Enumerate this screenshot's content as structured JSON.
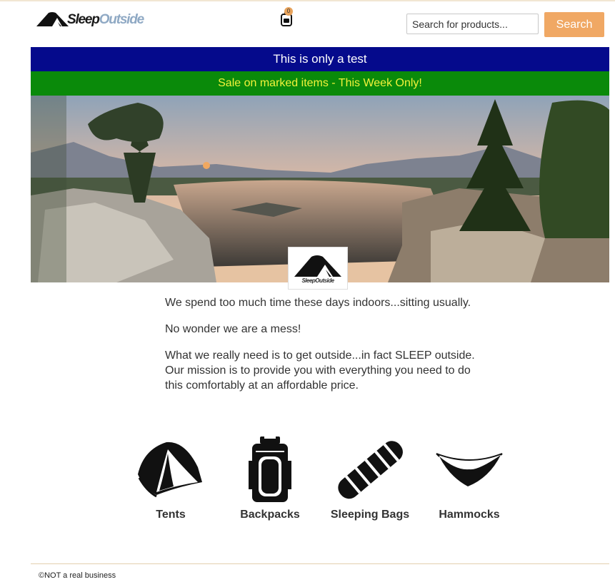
{
  "header": {
    "logo": {
      "text_main": "Sleep",
      "text_accent": "Outside",
      "icon": "tent-icon"
    },
    "cart": {
      "icon": "backpack-cart-icon",
      "count": "0"
    },
    "search": {
      "placeholder": "Search for products...",
      "button_label": "Search"
    }
  },
  "alerts": [
    {
      "text": "This is only a test",
      "background": "#050a8c",
      "color": "#ffffff"
    },
    {
      "text": "Sale on marked items - This Week Only!",
      "background": "#0a8a0a",
      "color": "#f2f23a"
    }
  ],
  "hero": {
    "image": "mountain-lake-sunset-photo",
    "badge_text": "SleepOutside"
  },
  "intro": {
    "p1": "We spend too much time these days indoors...sitting usually.",
    "p2": "No wonder we are a mess!",
    "p3": "What we really need is to get outside...in fact SLEEP outside. Our mission is to provide you with everything you need to do this comfortably at an affordable price."
  },
  "categories": [
    {
      "label": "Tents",
      "icon": "tent-icon"
    },
    {
      "label": "Backpacks",
      "icon": "backpack-icon"
    },
    {
      "label": "Sleeping Bags",
      "icon": "sleeping-bag-icon"
    },
    {
      "label": "Hammocks",
      "icon": "hammock-icon"
    }
  ],
  "footer": {
    "text": "©NOT a real business"
  },
  "colors": {
    "accent": "#f0a864",
    "logo_accent": "#8fa9c4",
    "footer_rule": "#e3cfad"
  }
}
